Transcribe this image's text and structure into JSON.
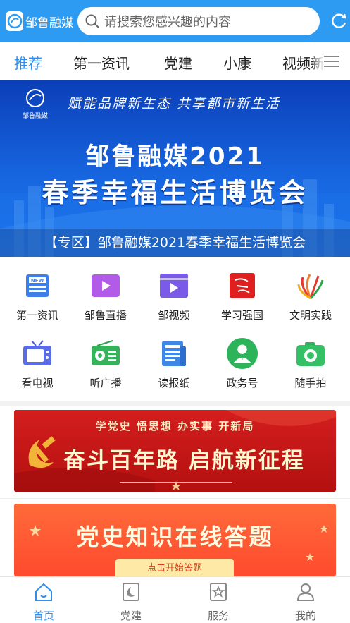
{
  "header": {
    "app_name": "邹鲁融媒",
    "search_placeholder": "请搜索您感兴趣的内容"
  },
  "tabs": [
    {
      "label": "推荐",
      "active": true
    },
    {
      "label": "第一资讯",
      "active": false
    },
    {
      "label": "党建",
      "active": false
    },
    {
      "label": "小康",
      "active": false
    },
    {
      "label": "视频新",
      "active": false
    }
  ],
  "banner": {
    "slogan": "赋能品牌新生态  共享都市新生活",
    "brand": "邹鲁融媒",
    "title_line1": "邹鲁融媒2021",
    "title_line2": "春季幸福生活博览会",
    "caption": "【专区】邹鲁融媒2021春季幸福生活博览会"
  },
  "grid": [
    {
      "label": "第一资讯",
      "icon": "news-icon"
    },
    {
      "label": "邹鲁直播",
      "icon": "live-icon"
    },
    {
      "label": "邹视频",
      "icon": "video-icon"
    },
    {
      "label": "学习强国",
      "icon": "xuexi-icon"
    },
    {
      "label": "文明实践",
      "icon": "civilization-icon"
    },
    {
      "label": "看电视",
      "icon": "tv-icon"
    },
    {
      "label": "听广播",
      "icon": "radio-icon"
    },
    {
      "label": "读报纸",
      "icon": "newspaper-icon"
    },
    {
      "label": "政务号",
      "icon": "government-icon"
    },
    {
      "label": "随手拍",
      "icon": "camera-icon"
    }
  ],
  "party_banner": {
    "top": "学党史 悟思想 办实事 开新局",
    "main": "奋斗百年路 启航新征程"
  },
  "quiz_banner": {
    "title": "党史知识在线答题",
    "button": "点击开始答题"
  },
  "bottom_nav": [
    {
      "label": "首页",
      "icon": "home-icon",
      "active": true
    },
    {
      "label": "党建",
      "icon": "party-icon",
      "active": false
    },
    {
      "label": "服务",
      "icon": "service-icon",
      "active": false
    },
    {
      "label": "我的",
      "icon": "profile-icon",
      "active": false
    }
  ],
  "colors": {
    "primary": "#2e9bf2",
    "active_text": "#2e8ff0",
    "party_red": "#c8161a",
    "quiz_orange": "#ff5a34"
  }
}
